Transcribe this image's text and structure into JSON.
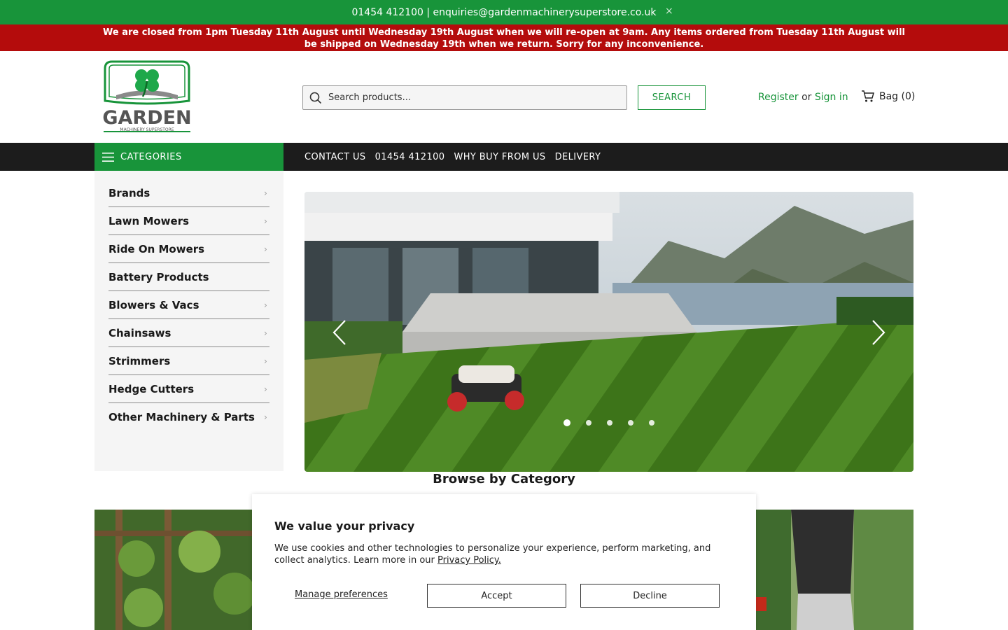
{
  "topbar": {
    "contact": "01454 412100 | enquiries@gardenmachinerysuperstore.co.uk",
    "close": "×"
  },
  "notice": {
    "text": "We are closed from 1pm Tuesday 11th August until Wednesday 19th August when we will re-open at 9am.  Any items ordered from Tuesday 11th August will be shipped on Wednesday 19th when we return. Sorry for any inconvenience."
  },
  "logo": {
    "word": "GARDEN",
    "tagline": "MACHINERY SUPERSTORE"
  },
  "search": {
    "placeholder": "Search products...",
    "button": "SEARCH"
  },
  "account": {
    "register": "Register",
    "or": "or",
    "signin": "Sign in"
  },
  "bag": {
    "label": "Bag (0)"
  },
  "nav": {
    "categories": "CATEGORIES",
    "links": [
      "CONTACT US",
      "01454 412100",
      "WHY BUY FROM US",
      "DELIVERY"
    ]
  },
  "sidebar": {
    "items": [
      {
        "label": "Brands",
        "chevron": "›"
      },
      {
        "label": "Lawn Mowers",
        "chevron": "›"
      },
      {
        "label": "Ride On Mowers",
        "chevron": "›"
      },
      {
        "label": "Battery Products",
        "chevron": ""
      },
      {
        "label": "Blowers & Vacs",
        "chevron": "›"
      },
      {
        "label": "Chainsaws",
        "chevron": "›"
      },
      {
        "label": "Strimmers",
        "chevron": "›"
      },
      {
        "label": "Hedge Cutters",
        "chevron": "›"
      },
      {
        "label": "Other Machinery & Parts",
        "chevron": "›"
      }
    ]
  },
  "hero": {
    "slides": 5,
    "active_slide": 1
  },
  "browse": {
    "title": "Browse by Category"
  },
  "cookie": {
    "title": "We value your privacy",
    "body": "We use cookies and other technologies to personalize your experience, perform marketing, and collect analytics. Learn more in our ",
    "link": "Privacy Policy.",
    "manage": "Manage preferences",
    "accept": "Accept",
    "decline": "Decline"
  },
  "colors": {
    "brand_green": "#18943a",
    "notice_red": "#b40c0c",
    "nav_dark": "#1c1c1c"
  }
}
